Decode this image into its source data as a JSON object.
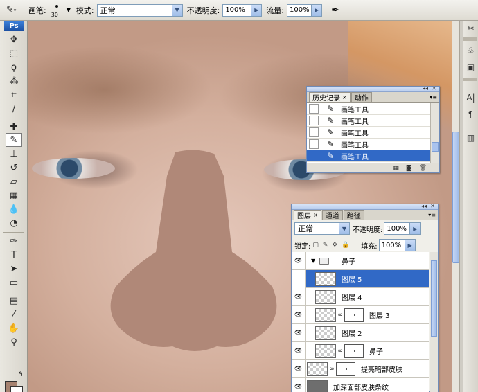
{
  "options_bar": {
    "brush_label": "画笔:",
    "brush_size": "30",
    "mode_label": "模式:",
    "mode_value": "正常",
    "opacity_label": "不透明度:",
    "opacity_value": "100%",
    "flow_label": "流量:",
    "flow_value": "100%"
  },
  "toolbox": {
    "logo": "Ps",
    "foreground_color": "#a68270",
    "background_color": "#ffffff"
  },
  "history_panel": {
    "tabs": [
      {
        "label": "历史记录",
        "active": true
      },
      {
        "label": "动作",
        "active": false
      }
    ],
    "items": [
      {
        "label": "画笔工具",
        "selected": false
      },
      {
        "label": "画笔工具",
        "selected": false
      },
      {
        "label": "画笔工具",
        "selected": false
      },
      {
        "label": "画笔工具",
        "selected": false
      },
      {
        "label": "画笔工具",
        "selected": true
      }
    ]
  },
  "layers_panel": {
    "tabs": [
      {
        "label": "图层",
        "active": true
      },
      {
        "label": "通道",
        "active": false
      },
      {
        "label": "路径",
        "active": false
      }
    ],
    "blend_mode": "正常",
    "opacity_label": "不透明度:",
    "opacity_value": "100%",
    "lock_label": "锁定:",
    "fill_label": "填充:",
    "fill_value": "100%",
    "layers": [
      {
        "name": "鼻子",
        "type": "group",
        "selected": false
      },
      {
        "name": "图层 5",
        "type": "layer",
        "selected": true
      },
      {
        "name": "图层 4",
        "type": "layer",
        "selected": false
      },
      {
        "name": "图层 3",
        "type": "layer-mask",
        "selected": false
      },
      {
        "name": "图层 2",
        "type": "layer",
        "selected": false
      },
      {
        "name": "鼻子",
        "type": "layer-mask",
        "selected": false
      },
      {
        "name": "提亮暗部皮肤",
        "type": "layer-mask-outer",
        "selected": false
      },
      {
        "name": "加深面部皮肤条纹",
        "type": "layer-dark",
        "selected": false
      }
    ]
  }
}
